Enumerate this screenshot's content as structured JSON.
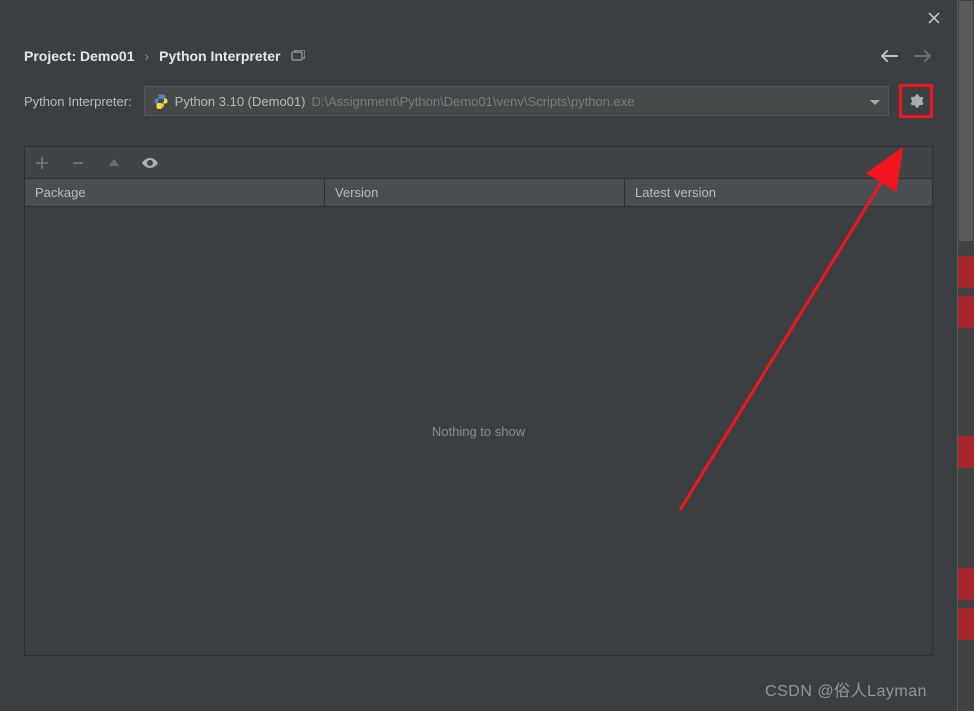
{
  "titlebar": {},
  "breadcrumb": {
    "project_label": "Project: Demo01",
    "page_label": "Python Interpreter"
  },
  "interpreter": {
    "field_label": "Python Interpreter:",
    "selected_name": "Python 3.10 (Demo01)",
    "selected_path": "D:\\Assignment\\Python\\Demo01\\venv\\Scripts\\python.exe"
  },
  "packages": {
    "columns": {
      "package": "Package",
      "version": "Version",
      "latest": "Latest version"
    },
    "rows": [],
    "empty_text": "Nothing to show"
  },
  "watermark": "CSDN @俗人Layman"
}
